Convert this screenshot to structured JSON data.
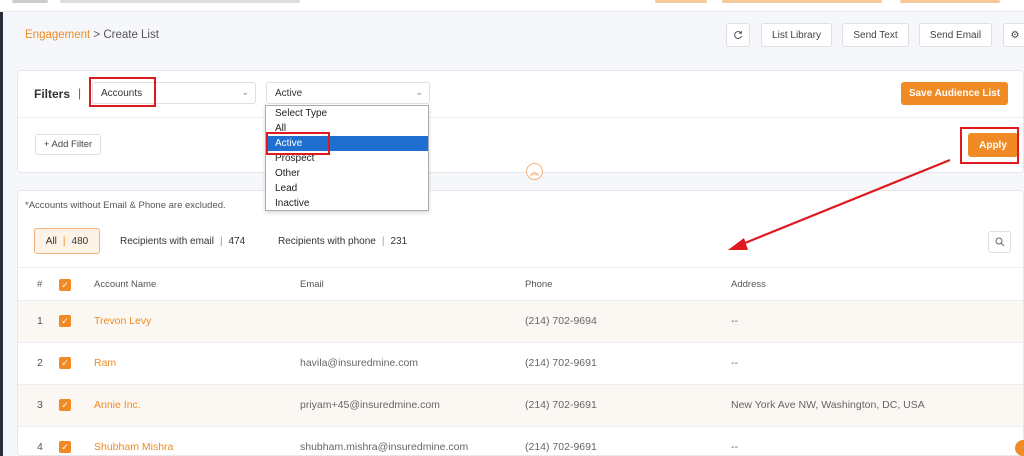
{
  "breadcrumb": {
    "parent": "Engagement",
    "separator": " > ",
    "current": "Create List"
  },
  "header_buttons": {
    "refresh_icon": "refresh-icon",
    "list_library": "List Library",
    "send_text": "Send Text",
    "send_email": "Send Email",
    "settings_icon": "gear-icon"
  },
  "filters": {
    "label": "Filters",
    "pipe": "|",
    "module_select": {
      "value": "Accounts"
    },
    "type_select": {
      "value": "Active"
    },
    "save_button": "Save Audience List",
    "add_filter": "+ Add Filter",
    "apply_button": "Apply",
    "type_options": [
      "Select Type",
      "All",
      "Active",
      "Prospect",
      "Other",
      "Lead",
      "Inactive"
    ],
    "selected_option": "Active"
  },
  "table_section": {
    "note": "*Accounts without Email & Phone are excluded.",
    "segments": [
      {
        "label": "All",
        "count": "480"
      },
      {
        "label": "Recipients with email",
        "count": "474"
      },
      {
        "label": "Recipients with phone",
        "count": "231"
      }
    ],
    "columns": [
      "#",
      "Account Name",
      "Email",
      "Phone",
      "Address"
    ],
    "rows": [
      {
        "num": "1",
        "name": "Trevon Levy",
        "email": "",
        "phone": "(214) 702-9694",
        "address": "--"
      },
      {
        "num": "2",
        "name": "Ram",
        "email": "havila@insuredmine.com",
        "phone": "(214) 702-9691",
        "address": "--"
      },
      {
        "num": "3",
        "name": "Annie Inc.",
        "email": "priyam+45@insuredmine.com",
        "phone": "(214) 702-9691",
        "address": "New York Ave NW, Washington, DC, USA"
      },
      {
        "num": "4",
        "name": "Shubham Mishra",
        "email": "shubham.mishra@insuredmine.com",
        "phone": "(214) 702-9691",
        "address": "--"
      }
    ]
  },
  "colors": {
    "accent": "#f08a24",
    "highlight": "#e0191f",
    "selection": "#1f6fd1"
  }
}
